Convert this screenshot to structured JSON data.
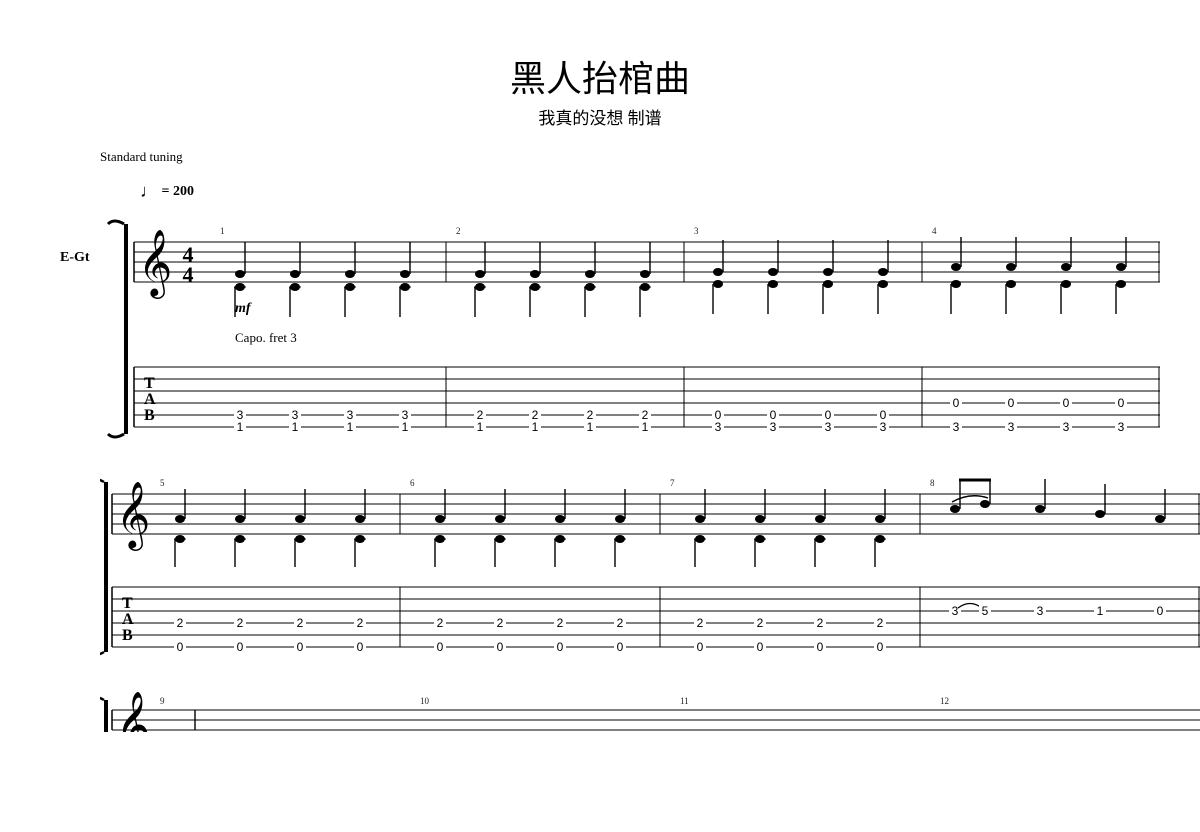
{
  "title": "黑人抬棺曲",
  "subtitle": "我真的没想 制谱",
  "tuning_label": "Standard tuning",
  "tempo_note": "♩",
  "tempo_eq": " = ",
  "tempo_value": "200",
  "instrument_label": "E-Gt",
  "time_sig_num": "4",
  "time_sig_den": "4",
  "dynamic": "mf",
  "capo": "Capo. fret 3",
  "tab_letters": {
    "t": "T",
    "a": "A",
    "b": "B"
  },
  "system1": {
    "bar_numbers": [
      "1",
      "2",
      "3",
      "4"
    ],
    "tab": [
      {
        "notes": [
          {
            "s5": "3",
            "s6": "1"
          },
          {
            "s5": "3",
            "s6": "1"
          },
          {
            "s5": "3",
            "s6": "1"
          },
          {
            "s5": "3",
            "s6": "1"
          }
        ]
      },
      {
        "notes": [
          {
            "s5": "2",
            "s6": "1"
          },
          {
            "s5": "2",
            "s6": "1"
          },
          {
            "s5": "2",
            "s6": "1"
          },
          {
            "s5": "2",
            "s6": "1"
          }
        ]
      },
      {
        "notes": [
          {
            "s5": "0",
            "s6": "3"
          },
          {
            "s5": "0",
            "s6": "3"
          },
          {
            "s5": "0",
            "s6": "3"
          },
          {
            "s5": "0",
            "s6": "3"
          }
        ]
      },
      {
        "notes": [
          {
            "s4": "0",
            "s6": "3"
          },
          {
            "s4": "0",
            "s6": "3"
          },
          {
            "s4": "0",
            "s6": "3"
          },
          {
            "s4": "0",
            "s6": "3"
          }
        ]
      }
    ]
  },
  "system2": {
    "bar_numbers": [
      "5",
      "6",
      "7",
      "8"
    ],
    "tab": [
      {
        "notes": [
          {
            "s4": "2",
            "s6": "0"
          },
          {
            "s4": "2",
            "s6": "0"
          },
          {
            "s4": "2",
            "s6": "0"
          },
          {
            "s4": "2",
            "s6": "0"
          }
        ]
      },
      {
        "notes": [
          {
            "s4": "2",
            "s6": "0"
          },
          {
            "s4": "2",
            "s6": "0"
          },
          {
            "s4": "2",
            "s6": "0"
          },
          {
            "s4": "2",
            "s6": "0"
          }
        ]
      },
      {
        "notes": [
          {
            "s4": "2",
            "s6": "0"
          },
          {
            "s4": "2",
            "s6": "0"
          },
          {
            "s4": "2",
            "s6": "0"
          },
          {
            "s4": "2",
            "s6": "0"
          }
        ]
      },
      {
        "notes": [
          {
            "s3": "3",
            "tie_to": "5"
          },
          {
            "s3": "5"
          },
          {
            "s3": "3"
          },
          {
            "s3": "1"
          },
          {
            "s3": "0",
            "last": true
          }
        ]
      }
    ]
  },
  "system3": {
    "bar_numbers": [
      "9",
      "10",
      "11",
      "12"
    ]
  }
}
